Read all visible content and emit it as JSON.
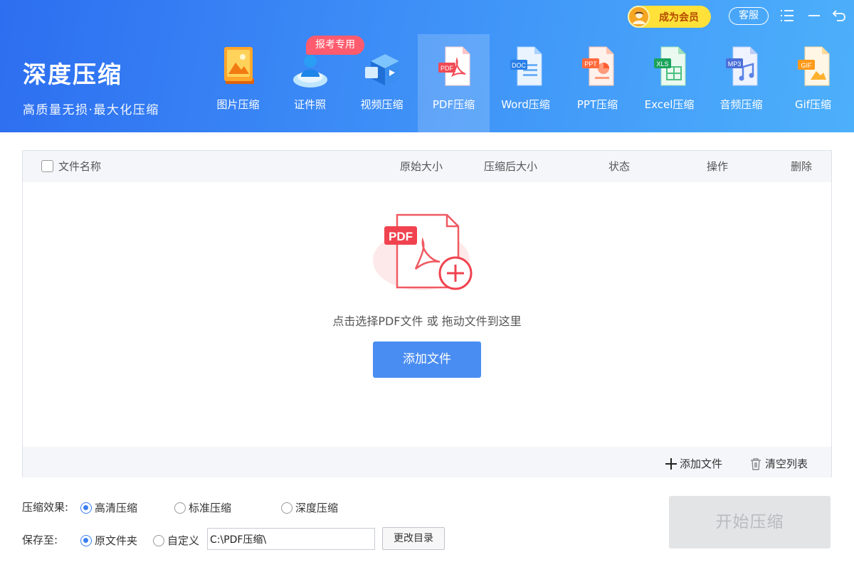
{
  "brand": {
    "title": "深度压缩",
    "subtitle": "高质量无损·最大化压缩"
  },
  "topbar": {
    "vip_label": "成为会员",
    "service_label": "客服",
    "menu_icon": "menu-icon",
    "back_icon": "back-icon"
  },
  "nav": {
    "badge": "报考专用",
    "items": [
      {
        "label": "图片压缩",
        "icon": "image-compress-icon"
      },
      {
        "label": "证件照",
        "icon": "id-photo-icon"
      },
      {
        "label": "视频压缩",
        "icon": "video-compress-icon"
      },
      {
        "label": "PDF压缩",
        "icon": "pdf-compress-icon",
        "active": true
      },
      {
        "label": "Word压缩",
        "icon": "word-compress-icon"
      },
      {
        "label": "PPT压缩",
        "icon": "ppt-compress-icon"
      },
      {
        "label": "Excel压缩",
        "icon": "excel-compress-icon"
      },
      {
        "label": "音频压缩",
        "icon": "audio-compress-icon"
      },
      {
        "label": "Gif压缩",
        "icon": "gif-compress-icon"
      }
    ],
    "icon_tags": {
      "pdf": "PDF",
      "doc": "DOC",
      "ppt": "PPT",
      "xls": "XLS",
      "mp3": "MP3",
      "gif": "GIF"
    }
  },
  "table": {
    "columns": {
      "name": "文件名称",
      "original": "原始大小",
      "compressed": "压缩后大小",
      "status": "状态",
      "action": "操作",
      "delete": "删除"
    }
  },
  "empty": {
    "illustration_tag": "PDF",
    "hint": "点击选择PDF文件 或 拖动文件到这里",
    "add_button": "添加文件"
  },
  "footer": {
    "add_file": "添加文件",
    "clear_list": "清空列表"
  },
  "options": {
    "effect_label": "压缩效果:",
    "effects": [
      "高清压缩",
      "标准压缩",
      "深度压缩"
    ],
    "effect_selected": "高清压缩",
    "save_label": "保存至:",
    "save_options": [
      "原文件夹",
      "自定义"
    ],
    "save_selected": "原文件夹",
    "path_value": "C:\\PDF压缩\\",
    "change_dir": "更改目录"
  },
  "start_button": "开始压缩",
  "colors": {
    "header_start": "#2d6ef0",
    "header_end": "#4db0fb",
    "accent": "#4a8df2",
    "pdf_red": "#f0434f",
    "vip_yellow": "#ffe13a"
  }
}
